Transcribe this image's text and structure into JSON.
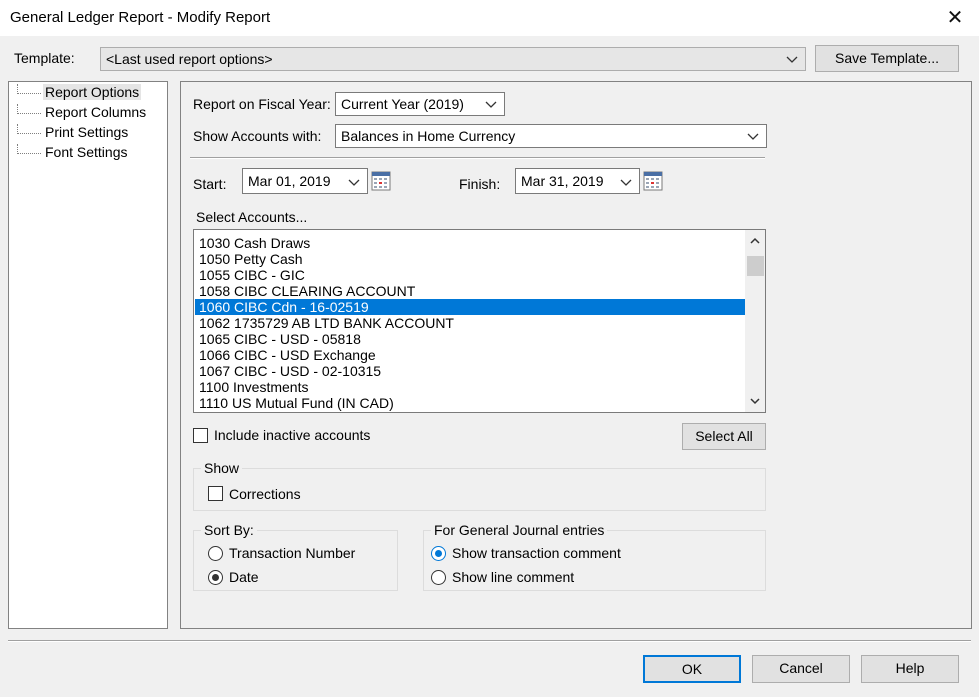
{
  "window": {
    "title": "General Ledger Report - Modify Report",
    "close_symbol": "✕"
  },
  "template": {
    "label": "Template:",
    "value": "<Last used report options>",
    "save_button": "Save Template..."
  },
  "tree": {
    "items": [
      {
        "label": "Report Options",
        "selected": true
      },
      {
        "label": "Report Columns"
      },
      {
        "label": "Print Settings"
      },
      {
        "label": "Font Settings"
      }
    ]
  },
  "options": {
    "fiscal_year_label": "Report on Fiscal Year:",
    "fiscal_year_value": "Current Year (2019)",
    "show_accounts_label": "Show Accounts with:",
    "show_accounts_value": "Balances in Home Currency",
    "start_label": "Start:",
    "start_value": "Mar 01, 2019",
    "finish_label": "Finish:",
    "finish_value": "Mar 31, 2019",
    "select_accounts_label": "Select Accounts..."
  },
  "accounts": [
    "1030 Cash Draws",
    "1050 Petty Cash",
    "1055 CIBC - GIC",
    "1058 CIBC CLEARING ACCOUNT",
    "1060 CIBC Cdn - 16-02519",
    "1062 1735729 AB LTD BANK ACCOUNT",
    "1065 CIBC - USD - 05818",
    "1066 CIBC - USD Exchange",
    "1067 CIBC - USD - 02-10315",
    "1100 Investments",
    "1110 US Mutual Fund (IN CAD)"
  ],
  "selected_account_index": 4,
  "include_inactive_label": "Include inactive accounts",
  "select_all_button": "Select All",
  "show_group": {
    "title": "Show",
    "corrections_label": "Corrections"
  },
  "sort_group": {
    "title": "Sort By:",
    "option_transaction_number": "Transaction Number",
    "option_date": "Date",
    "selected": "Date"
  },
  "journal_group": {
    "title": "For General Journal entries",
    "option_transaction_comment": "Show transaction comment",
    "option_line_comment": "Show line comment",
    "selected": "Show transaction comment"
  },
  "footer": {
    "ok": "OK",
    "cancel": "Cancel",
    "help": "Help"
  },
  "colors": {
    "selection": "#0078d7",
    "dialog_bg": "#f0f0f0"
  }
}
